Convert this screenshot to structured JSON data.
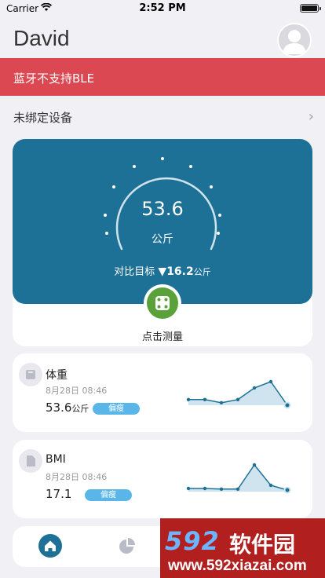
{
  "status_bar": {
    "carrier": "Carrier",
    "time": "2:52 PM",
    "icons": [
      "wifi-icon",
      "battery-icon"
    ]
  },
  "header": {
    "user_name": "David",
    "avatar_icon": "person-avatar-icon"
  },
  "alert": {
    "text": "蓝牙不支持BLE",
    "color": "#dc4852"
  },
  "device": {
    "label": "未绑定设备",
    "chevron_icon": "chevron-right-icon"
  },
  "measurement": {
    "weight_value": "53.6",
    "weight_unit": "公斤",
    "compare_label": "对比目标",
    "compare_arrow": "▼",
    "compare_delta": "16.2",
    "compare_unit": "公斤",
    "action_label": "点击测量",
    "action_icon": "scale-icon",
    "panel_color": "#1e7196",
    "button_color": "#5aa13a"
  },
  "metrics": [
    {
      "title": "体重",
      "icon": "scale-icon",
      "date": "8月28日 08:46",
      "value": "53.6",
      "unit": "公斤",
      "badge": "偏瘦",
      "trend": [
        0.18,
        0.18,
        0.08,
        0.18,
        0.55,
        0.75,
        0.0
      ]
    },
    {
      "title": "BMI",
      "icon": "document-icon",
      "date": "8月28日 08:46",
      "value": "17.1",
      "unit": "",
      "badge": "偏瘦",
      "trend": [
        0.1,
        0.1,
        0.08,
        0.08,
        0.85,
        0.2,
        0.05
      ]
    }
  ],
  "tab_bar": {
    "icons": [
      "home-icon",
      "pie-chart-icon"
    ]
  },
  "watermark": {
    "brand_number": "592",
    "brand_name": "软件园",
    "url": "www.592xiazai.com"
  },
  "colors": {
    "accent": "#1e7196",
    "badge": "#5ab6e8",
    "background": "#f1f1f5"
  }
}
